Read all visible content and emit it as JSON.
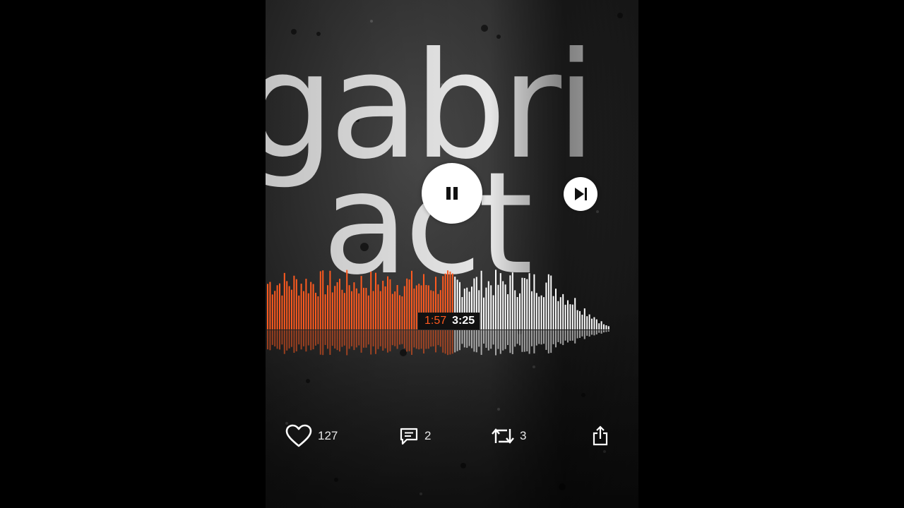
{
  "artwork": {
    "title_lines": [
      "gabri",
      "act"
    ]
  },
  "player": {
    "elapsed": "1:57",
    "duration": "3:25",
    "progress_fraction": 0.571,
    "played_color": "#ff5a1f",
    "unplayed_color": "#ffffff",
    "pause_icon": "pause-icon",
    "next_icon": "skip-next-icon"
  },
  "actions": {
    "likes": "127",
    "comments": "2",
    "reposts": "3",
    "like_icon": "heart-icon",
    "comment_icon": "comment-icon",
    "repost_icon": "repost-icon",
    "share_icon": "share-icon"
  }
}
